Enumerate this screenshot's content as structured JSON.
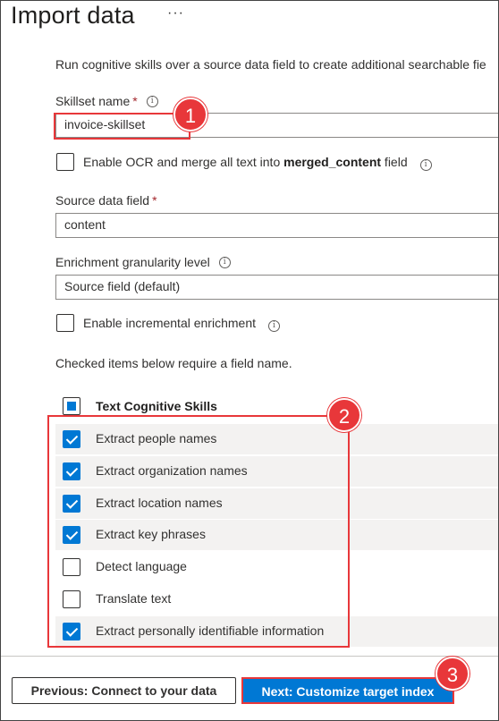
{
  "header": {
    "title": "Import data",
    "more": "···"
  },
  "description": "Run cognitive skills over a source data field to create additional searchable fie",
  "skillset": {
    "label": "Skillset name",
    "required": "*",
    "value": "invoice-skillset"
  },
  "ocr": {
    "prefix": "Enable OCR and merge all text into ",
    "bold": "merged_content",
    "suffix": " field",
    "checked": false
  },
  "source": {
    "label": "Source data field",
    "required": "*",
    "value": "content"
  },
  "granularity": {
    "label": "Enrichment granularity level",
    "value": "Source field (default)"
  },
  "incremental": {
    "label": "Enable incremental enrichment",
    "checked": false
  },
  "note": "Checked items below require a field name.",
  "skills": {
    "header": "Text Cognitive Skills",
    "items": [
      {
        "label": "Extract people names",
        "checked": true
      },
      {
        "label": "Extract organization names",
        "checked": true
      },
      {
        "label": "Extract location names",
        "checked": true
      },
      {
        "label": "Extract key phrases",
        "checked": true
      },
      {
        "label": "Detect language",
        "checked": false
      },
      {
        "label": "Translate text",
        "checked": false
      },
      {
        "label": "Extract personally identifiable information",
        "checked": true
      }
    ]
  },
  "callouts": [
    "1",
    "2",
    "3"
  ],
  "buttons": {
    "previous": "Previous: Connect to your data",
    "next": "Next: Customize target index"
  },
  "colors": {
    "accent": "#0078d4",
    "callout": "#e8373a",
    "required": "#a4262c"
  }
}
